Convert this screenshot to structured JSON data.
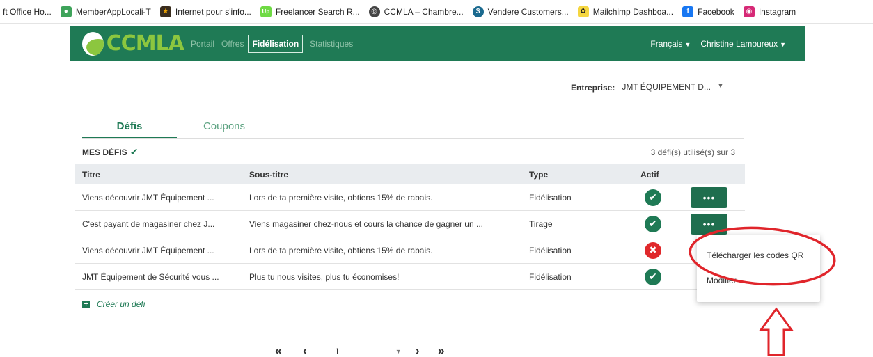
{
  "bookmarks": [
    {
      "label": "ft Office Ho...",
      "icon": "office-icon",
      "color": ""
    },
    {
      "label": "MemberAppLocali-T",
      "icon": "map-pin-icon",
      "color": "#3ea35a"
    },
    {
      "label": "Internet pour s'info...",
      "icon": "star-icon",
      "color": "#3a2d1e"
    },
    {
      "label": "Freelancer Search R...",
      "icon": "upwork-icon",
      "color": "#6fda44"
    },
    {
      "label": "CCMLA – Chambre...",
      "icon": "globe-icon",
      "color": "#444444"
    },
    {
      "label": "Vendere Customers...",
      "icon": "vendere-icon",
      "color": "#1b6a8f"
    },
    {
      "label": "Mailchimp Dashboa...",
      "icon": "mailchimp-icon",
      "color": "#f5d640"
    },
    {
      "label": "Facebook",
      "icon": "facebook-icon",
      "color": "#1877f2"
    },
    {
      "label": "Instagram",
      "icon": "instagram-icon",
      "color": "#d62976"
    }
  ],
  "navbar": {
    "logo_text": "CCMLA",
    "items": [
      "Portail",
      "Offres",
      "Fidélisation",
      "Statistiques"
    ],
    "active_item": "Fidélisation",
    "language": "Français",
    "user": "Christine Lamoureux"
  },
  "company": {
    "label": "Entreprise:",
    "value": "JMT ÉQUIPEMENT D..."
  },
  "tabs": {
    "defis": "Défis",
    "coupons": "Coupons"
  },
  "section": {
    "title": "MES DÉFIS",
    "usage": "3 défi(s) utilisé(s) sur 3"
  },
  "table": {
    "headers": [
      "Titre",
      "Sous-titre",
      "Type",
      "Actif"
    ],
    "rows": [
      {
        "title": "Viens découvrir JMT Équipement ...",
        "subtitle": "Lors de ta première visite, obtiens 15% de rabais.",
        "type": "Fidélisation",
        "active": true
      },
      {
        "title": "C'est payant de magasiner chez J...",
        "subtitle": "Viens magasiner chez-nous et cours la chance de gagner un ...",
        "type": "Tirage",
        "active": true
      },
      {
        "title": "Viens découvrir JMT Équipement ...",
        "subtitle": "Lors de ta première visite, obtiens 15% de rabais.",
        "type": "Fidélisation",
        "active": false
      },
      {
        "title": "JMT Équipement de Sécurité vous ...",
        "subtitle": "Plus tu nous visites, plus tu économises!",
        "type": "Fidélisation",
        "active": true
      }
    ],
    "more_label": "•••"
  },
  "create_label": "Créer un défi",
  "menu": {
    "download": "Télécharger les codes QR",
    "modify": "Modifier"
  },
  "pager": {
    "first": "«",
    "prev": "‹",
    "page": "1",
    "next": "›",
    "last": "»"
  },
  "colors": {
    "brand": "#1f7a55",
    "danger": "#e0282b",
    "annotation": "#e0252b"
  }
}
